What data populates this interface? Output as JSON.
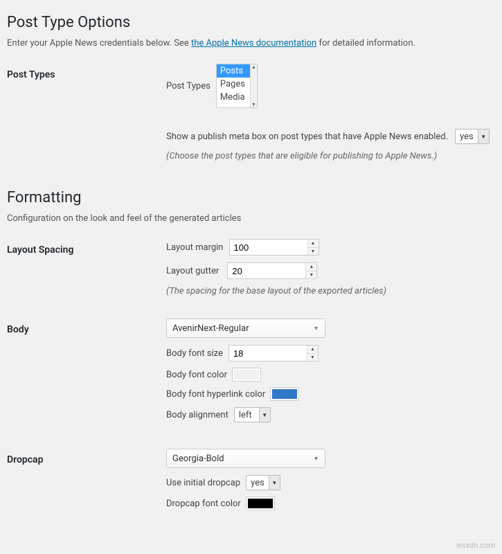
{
  "sections": {
    "postTypeOptions": {
      "title": "Post Type Options",
      "descPrefix": "Enter your Apple News credentials below. See ",
      "descLinkText": "the Apple News documentation",
      "descSuffix": " for detailed information."
    },
    "formatting": {
      "title": "Formatting",
      "desc": "Configuration on the look and feel of the generated articles"
    }
  },
  "postTypes": {
    "rowLabel": "Post Types",
    "subLabel": "Post Types",
    "options": [
      "Posts",
      "Pages",
      "Media"
    ],
    "selected": "Posts",
    "metaBoxLabel": "Show a publish meta box on post types that have Apple News enabled.",
    "metaBoxValue": "yes",
    "helper": "(Choose the post types that are eligible for publishing to Apple News.)"
  },
  "layout": {
    "rowLabel": "Layout Spacing",
    "marginLabel": "Layout margin",
    "marginValue": "100",
    "gutterLabel": "Layout gutter",
    "gutterValue": "20",
    "helper": "(The spacing for the base layout of the exported articles)"
  },
  "body": {
    "rowLabel": "Body",
    "fontValue": "AvenirNext-Regular",
    "fontSizeLabel": "Body font size",
    "fontSizeValue": "18",
    "fontColorLabel": "Body font color",
    "fontColorValue": "#000000",
    "hyperlinkColorLabel": "Body font hyperlink color",
    "hyperlinkColorValue": "#3078c8",
    "alignmentLabel": "Body alignment",
    "alignmentValue": "left"
  },
  "dropcap": {
    "rowLabel": "Dropcap",
    "fontValue": "Georgia-Bold",
    "useLabel": "Use initial dropcap",
    "useValue": "yes",
    "fontColorLabel": "Dropcap font color",
    "fontColorValue": "#000000"
  },
  "watermark": "wsxdn.com"
}
